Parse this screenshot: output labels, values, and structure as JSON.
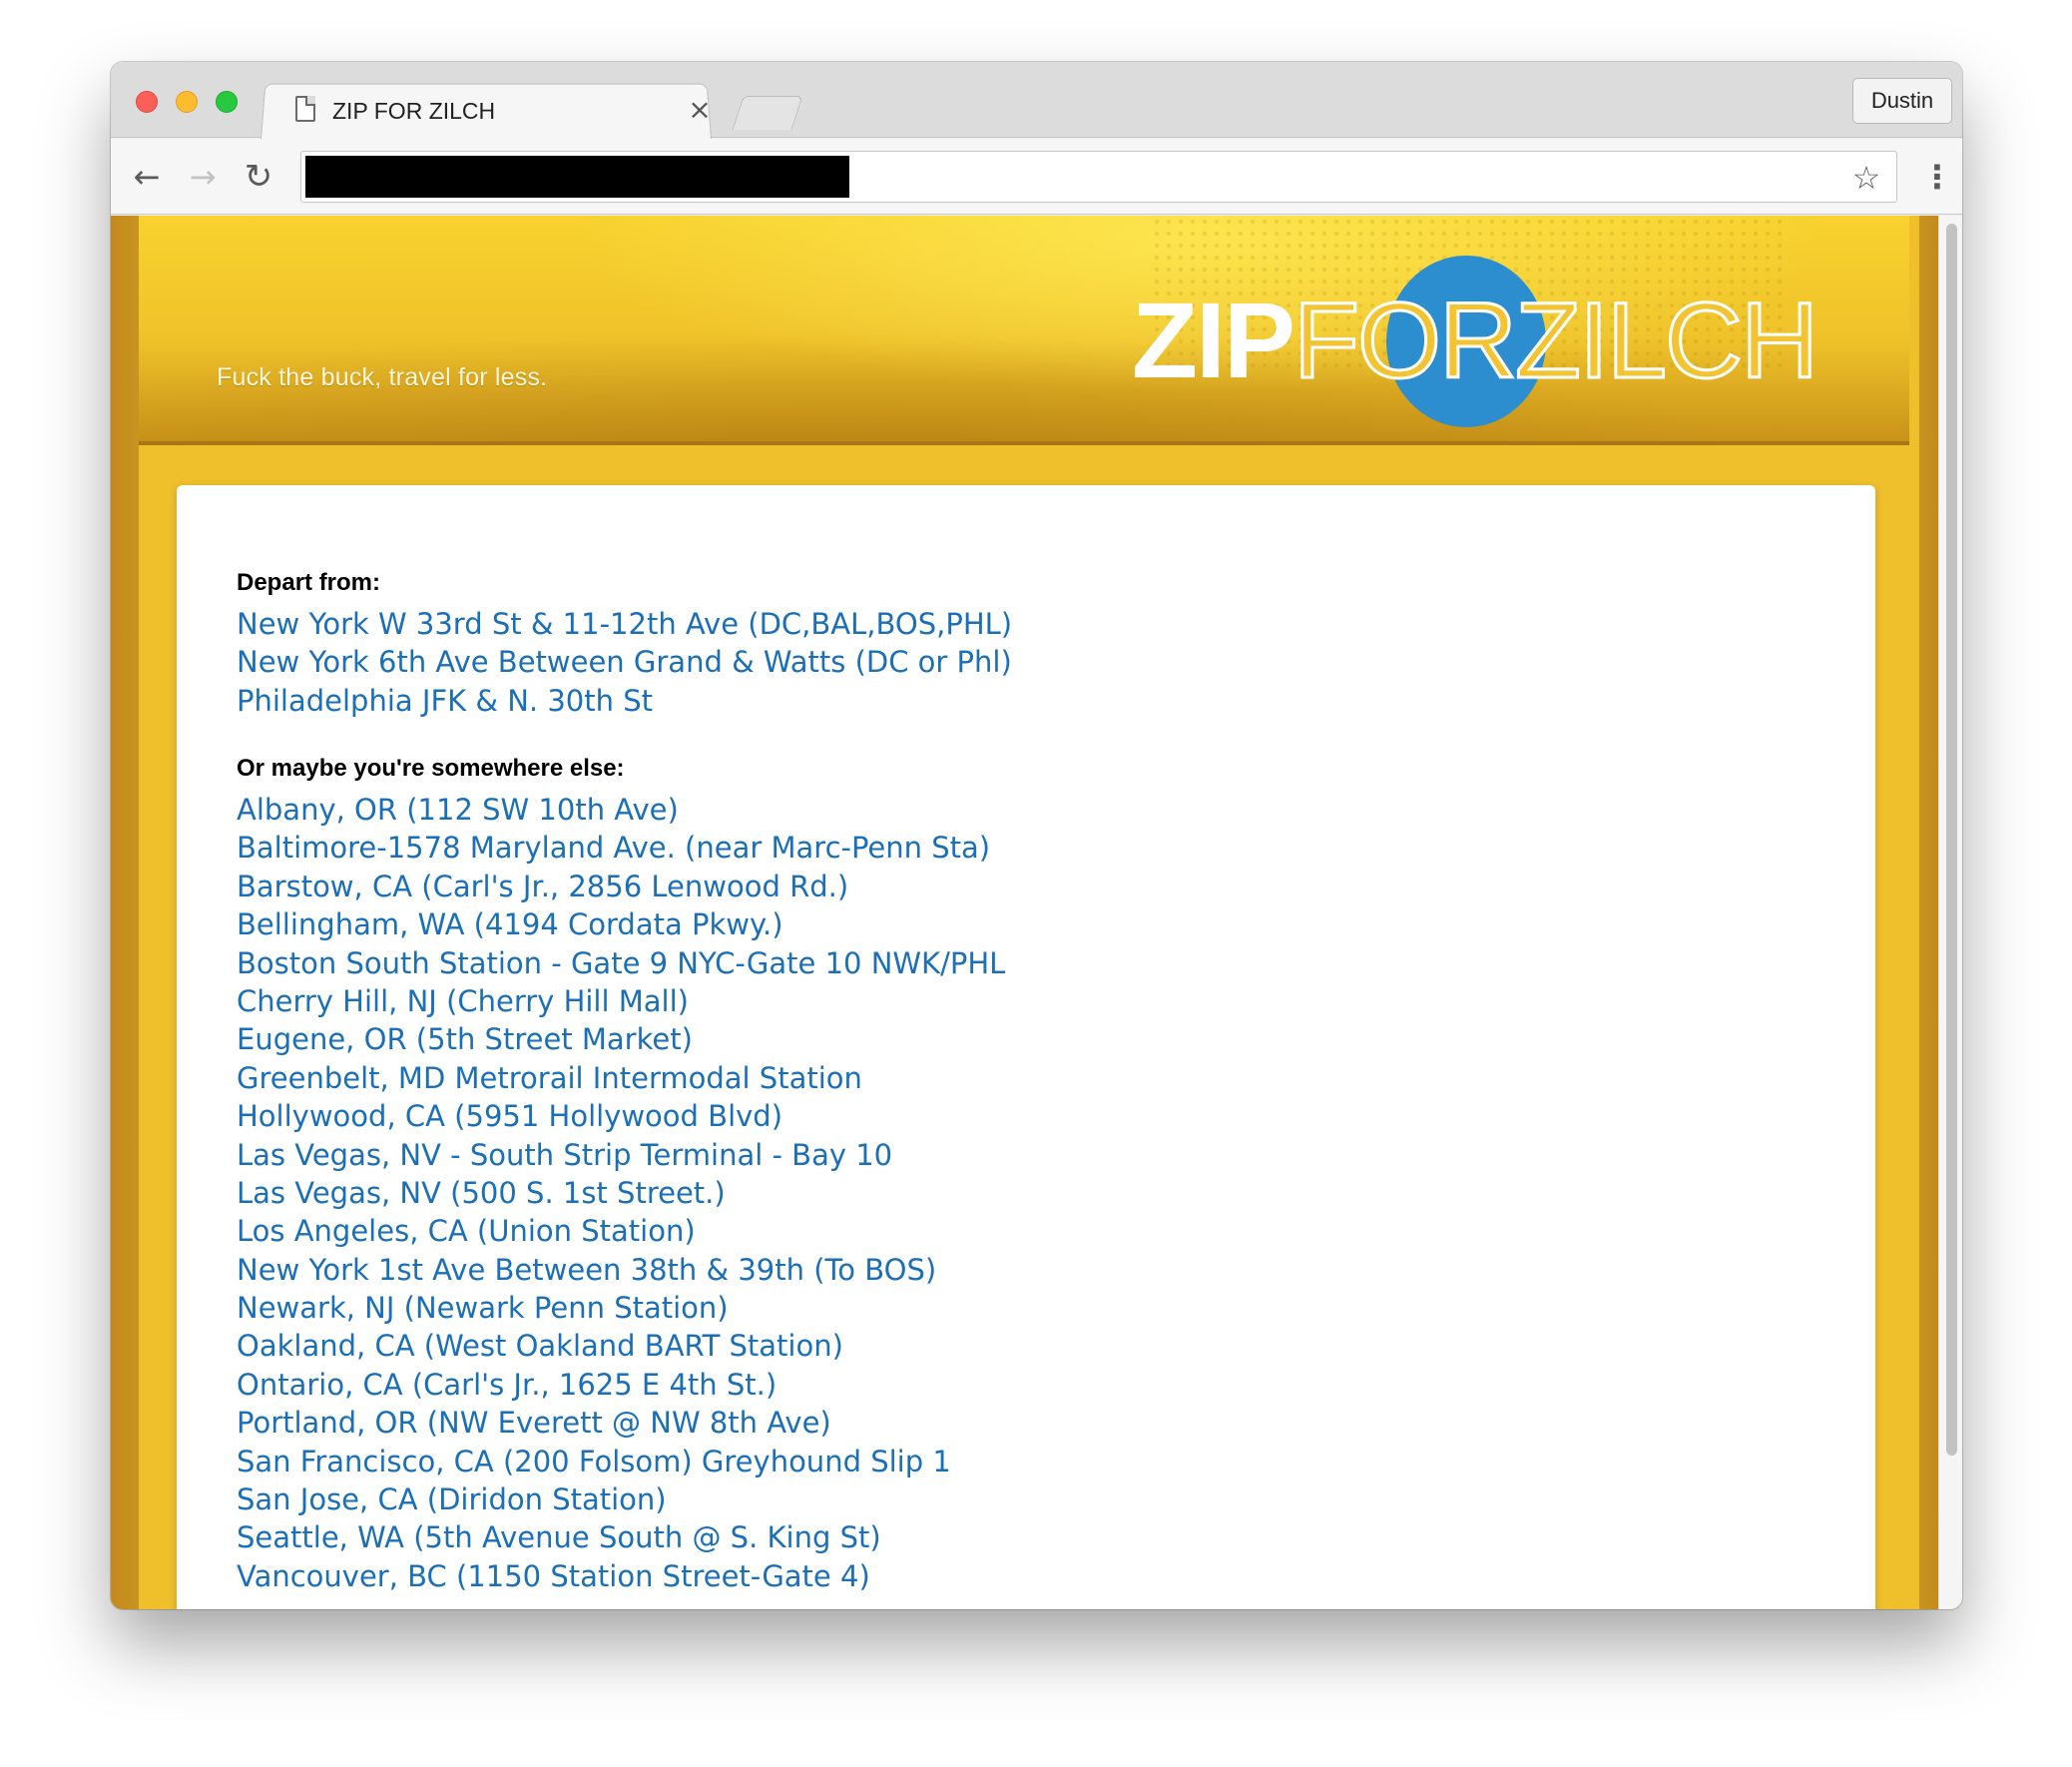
{
  "browser": {
    "tab_title": "ZIP FOR ZILCH",
    "tab_close": "×",
    "profile_name": "Dustin",
    "back_icon": "←",
    "forward_icon": "→",
    "reload_icon": "↻",
    "star_icon": "☆",
    "menu_icon": "⋮"
  },
  "banner": {
    "tagline": "Fuck the buck, travel for less.",
    "logo_zip": "ZIP",
    "logo_rest": "FORZILCH",
    "colors": {
      "banner": "#efc02c",
      "logo_circle": "#2c8ecf"
    }
  },
  "main": {
    "depart_label": "Depart from:",
    "primary_stops": [
      "New York W 33rd St & 11-12th Ave (DC,BAL,BOS,PHL)",
      "New York 6th Ave Between Grand & Watts (DC or Phl)",
      "Philadelphia JFK & N. 30th St"
    ],
    "other_label": "Or maybe you're somewhere else:",
    "other_stops": [
      "Albany, OR (112 SW 10th Ave)",
      "Baltimore-1578 Maryland Ave. (near Marc-Penn Sta)",
      "Barstow, CA (Carl's Jr., 2856 Lenwood Rd.)",
      "Bellingham, WA (4194 Cordata Pkwy.)",
      "Boston South Station - Gate 9 NYC-Gate 10 NWK/PHL",
      "Cherry Hill, NJ (Cherry Hill Mall)",
      "Eugene, OR (5th Street Market)",
      "Greenbelt, MD Metrorail Intermodal Station",
      "Hollywood, CA (5951 Hollywood Blvd)",
      "Las Vegas, NV - South Strip Terminal - Bay 10",
      "Las Vegas, NV (500 S. 1st Street.)",
      "Los Angeles, CA (Union Station)",
      "New York 1st Ave Between 38th & 39th (To BOS)",
      "Newark, NJ (Newark Penn Station)",
      "Oakland, CA (West Oakland BART Station)",
      "Ontario, CA (Carl's Jr., 1625 E 4th St.)",
      "Portland, OR (NW Everett @ NW 8th Ave)",
      "San Francisco, CA (200 Folsom) Greyhound Slip 1",
      "San Jose, CA (Diridon Station)",
      "Seattle, WA (5th Avenue South @ S. King St)",
      "Vancouver, BC (1150 Station Street-Gate 4)"
    ],
    "link_color": "#1a6fb8"
  }
}
